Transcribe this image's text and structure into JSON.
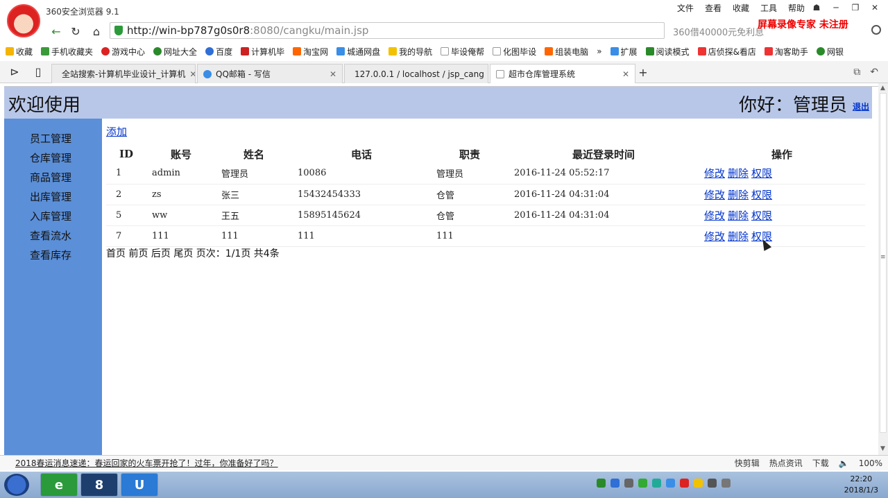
{
  "browser": {
    "app_name": "360安全浏览器 9.1",
    "menu": [
      "文件",
      "查看",
      "收藏",
      "工具",
      "帮助"
    ],
    "url_main": "http://win-bp787g0s0r8",
    "url_rest": ":8080/cangku/main.jsp",
    "search_hint": "360借40000元免利息",
    "watermark": "屏幕录像专家 未注册",
    "bookmarks": [
      "收藏",
      "手机收藏夹",
      "游戏中心",
      "网址大全",
      "百度",
      "计算机毕",
      "淘宝网",
      "城通网盘",
      "我的导航",
      "毕设俺帮",
      "化图毕设",
      "组装电脑",
      "»",
      "扩展",
      "阅读模式",
      "店侦探&看店",
      "淘客助手",
      "网银"
    ],
    "tabs": [
      {
        "label": "全站搜索-计算机毕业设计_计算机"
      },
      {
        "label": "QQ邮箱 - 写信"
      },
      {
        "label": "127.0.0.1 / localhost / jsp_cang"
      },
      {
        "label": "超市仓库管理系统"
      }
    ]
  },
  "page": {
    "welcome": "欢迎使用",
    "greeting": "你好：管理员",
    "logout": "退出",
    "sidebar": [
      "员工管理",
      "仓库管理",
      "商品管理",
      "出库管理",
      "入库管理",
      "查看流水",
      "查看库存"
    ],
    "add_label": "添加",
    "columns": [
      "ID",
      "账号",
      "姓名",
      "电话",
      "职责",
      "最近登录时间",
      "操作"
    ],
    "rows": [
      {
        "id": "1",
        "account": "admin",
        "name": "管理员",
        "phone": "10086",
        "role": "管理员",
        "last_login": "2016-11-24 05:52:17"
      },
      {
        "id": "2",
        "account": "zs",
        "name": "张三",
        "phone": "15432454333",
        "role": "仓管",
        "last_login": "2016-11-24 04:31:04"
      },
      {
        "id": "5",
        "account": "ww",
        "name": "王五",
        "phone": "15895145624",
        "role": "仓管",
        "last_login": "2016-11-24 04:31:04"
      },
      {
        "id": "7",
        "account": "111",
        "name": "111",
        "phone": "111",
        "role": "111",
        "last_login": ""
      }
    ],
    "actions": [
      "修改",
      "删除",
      "权限"
    ],
    "pager": "首页 前页 后页 尾页 页次：1/1页 共4条"
  },
  "statusbar": {
    "news": "2018春运消息速递：春运回家的火车票开抢了！过年，你准备好了吗？",
    "items": [
      "快剪辑",
      "热点资讯",
      "下载"
    ],
    "zoom": "100%"
  },
  "taskbar": {
    "time": "22:20",
    "date": "2018/1/3"
  }
}
